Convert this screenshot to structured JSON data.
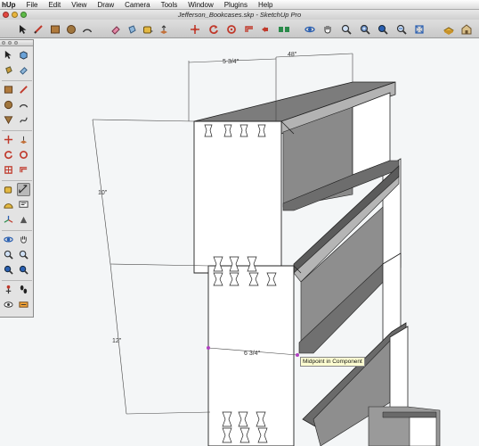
{
  "menu": {
    "app_name": "hUp",
    "items": [
      "File",
      "Edit",
      "View",
      "Draw",
      "Camera",
      "Tools",
      "Window",
      "Plugins",
      "Help"
    ]
  },
  "window": {
    "title": "Jefferson_Bookcases.skp - SketchUp Pro"
  },
  "toolbar": {
    "icons": [
      "select-icon",
      "pencil-line-icon",
      "rectangle-icon",
      "circle-icon",
      "arc-icon",
      "eraser-icon",
      "paint-bucket-icon",
      "tape-measure-icon",
      "push-pull-icon",
      "move-icon",
      "rotate-icon",
      "follow-me-icon",
      "offset-icon",
      "orbit-icon",
      "pan-icon",
      "zoom-icon",
      "zoom-window-icon",
      "zoom-extents-icon",
      "previous-view-icon",
      "components-icon",
      "warehouse-icon"
    ]
  },
  "palette": {
    "tools": [
      "select-icon",
      "component-icon",
      "paint-bucket-icon",
      "eraser-icon",
      "rectangle-icon",
      "line-icon",
      "circle-icon",
      "arc-icon",
      "polygon-icon",
      "freehand-icon",
      "move-icon",
      "push-pull-icon",
      "rotate-icon",
      "follow-me-icon",
      "scale-icon",
      "offset-icon",
      "tape-measure-icon",
      "dimension-icon",
      "protractor-icon",
      "text-icon",
      "axes-icon",
      "3d-text-icon",
      "orbit-icon",
      "pan-icon",
      "zoom-icon",
      "zoom-window-icon",
      "zoom-extents-icon",
      "previous-icon",
      "position-camera-icon",
      "walk-icon",
      "look-around-icon",
      "section-plane-icon"
    ],
    "selected": "dimension-icon"
  },
  "model": {
    "dimensions": {
      "width_top": "48\"",
      "depth_top": "5 3/4\"",
      "height_upper": "10\"",
      "height_lower": "12\"",
      "depth_mid": "6 3/4\""
    },
    "inference_tooltip": "Midpoint in Component"
  },
  "colors": {
    "accent": "#4a7fd0",
    "shelf_dark": "#5e5e5e",
    "shelf_mid": "#8c8c8c",
    "shelf_light": "#b6b6b6",
    "face_white": "#ffffff",
    "inference_magenta": "#b040c0"
  }
}
